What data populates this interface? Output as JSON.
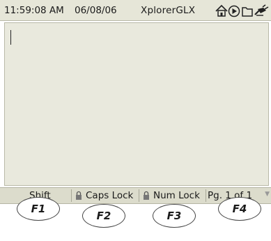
{
  "status_bar": {
    "time": "11:59:08 AM",
    "date": "06/08/06",
    "app_name": "XplorerGLX",
    "icons": [
      "home-icon",
      "play-icon",
      "folder-icon",
      "power-plug-icon"
    ]
  },
  "editor": {
    "text": ""
  },
  "function_bar": {
    "shift": "Shift",
    "caps_lock": "Caps Lock",
    "num_lock": "Num Lock",
    "page": "Pg. 1 of 1"
  },
  "function_keys": [
    "F1",
    "F2",
    "F3",
    "F4"
  ],
  "colors": {
    "status_bg": "#e6e6d8",
    "editor_bg": "#e9e9dd",
    "fbar_bg": "#dcdccc"
  }
}
